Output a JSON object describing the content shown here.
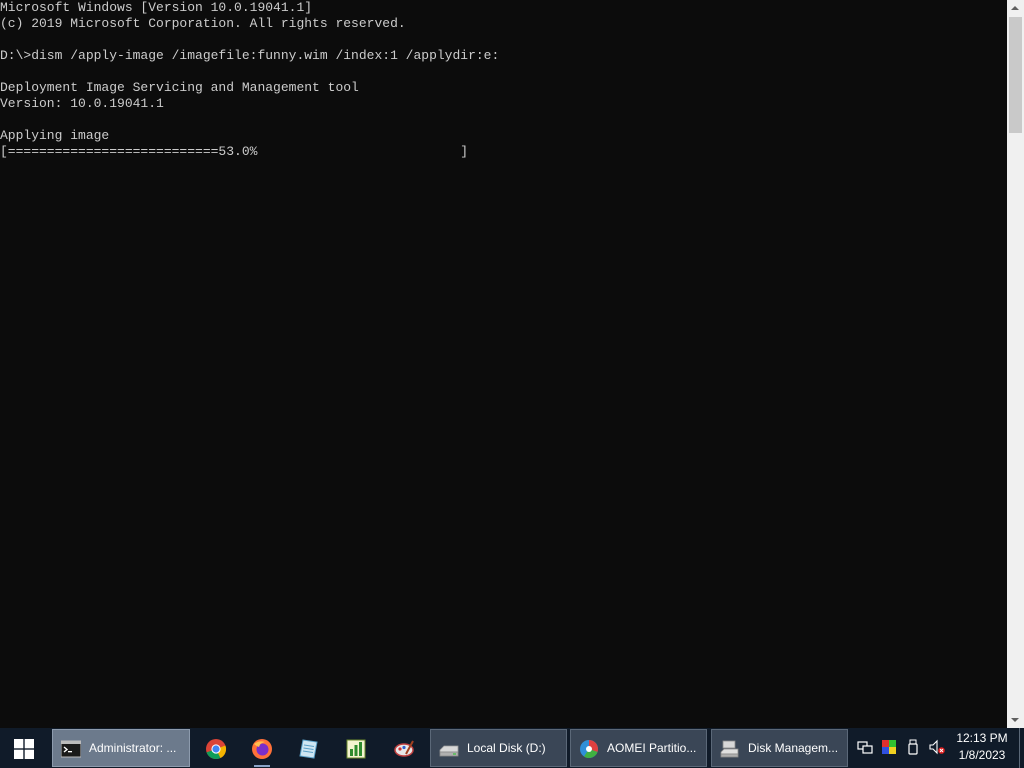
{
  "console": {
    "lines": [
      "Microsoft Windows [Version 10.0.19041.1]",
      "(c) 2019 Microsoft Corporation. All rights reserved.",
      "",
      "D:\\>dism /apply-image /imagefile:funny.wim /index:1 /applydir:e:",
      "",
      "Deployment Image Servicing and Management tool",
      "Version: 10.0.19041.1",
      "",
      "Applying image",
      "[===========================53.0%                          ]"
    ],
    "progress_percent": 53.0
  },
  "taskbar": {
    "start_icon": "windows-logo-icon",
    "pinned": [
      {
        "name": "chrome-icon"
      },
      {
        "name": "firefox-icon"
      },
      {
        "name": "notepad-paper-icon"
      },
      {
        "name": "chart-app-icon"
      },
      {
        "name": "paint-tool-icon"
      }
    ],
    "tasks": [
      {
        "label": "Administrator: ...",
        "icon": "command-prompt-icon"
      },
      {
        "label": "Local Disk (D:)",
        "icon": "drive-icon"
      },
      {
        "label": "AOMEI Partitio...",
        "icon": "aomei-icon"
      },
      {
        "label": "Disk Managem...",
        "icon": "disk-management-icon"
      }
    ],
    "tray_icons": [
      "network-icon",
      "color-display-icon",
      "usb-drive-icon",
      "volume-muted-icon"
    ],
    "clock": {
      "time": "12:13 PM",
      "date": "1/8/2023"
    }
  },
  "colors": {
    "console_bg": "#0c0c0c",
    "console_text": "#cccccc",
    "taskbar_bg": "#101b29"
  }
}
